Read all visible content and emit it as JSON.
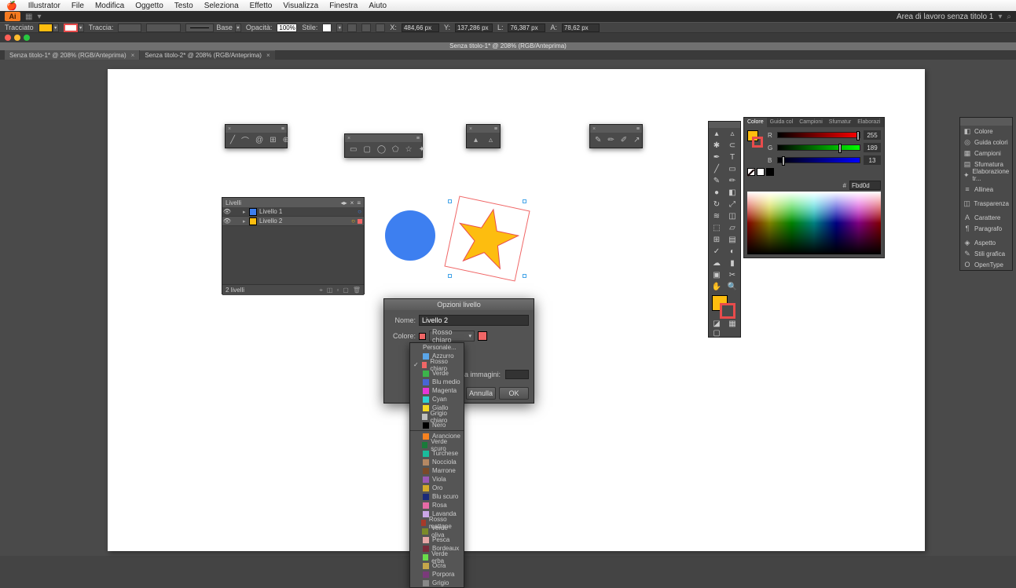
{
  "menubar": {
    "app": "Illustrator",
    "items": [
      "File",
      "Modifica",
      "Oggetto",
      "Testo",
      "Seleziona",
      "Effetto",
      "Visualizza",
      "Finestra",
      "Aiuto"
    ]
  },
  "appbar": {
    "workspace": "Area di lavoro senza titolo 1"
  },
  "controlbar": {
    "tracciato_label": "Tracciato",
    "traccia_label": "Traccia:",
    "base": "Base",
    "opacita_label": "Opacità:",
    "opacita": "100%",
    "stile_label": "Stile:",
    "x_label": "X:",
    "x": "484,66 px",
    "y_label": "Y:",
    "y": "137,286 px",
    "w_label": "L:",
    "w": "76,387 px",
    "h_label": "A:",
    "h": "78,62 px"
  },
  "titlebar": "Senza titolo-1* @ 208% (RGB/Anteprima)",
  "tabs": [
    {
      "label": "Senza titolo-1* @ 208% (RGB/Anteprima)",
      "active": true
    },
    {
      "label": "Senza titolo-2* @ 208% (RGB/Anteprima)",
      "active": false
    }
  ],
  "colorpanel": {
    "tabs": [
      "Colore",
      "Guida col",
      "Campioni",
      "Sfumatur",
      "Elaborazi"
    ],
    "r": "255",
    "g": "189",
    "b": "13",
    "hex": "Fbd0d"
  },
  "sidepanel": {
    "items": [
      {
        "icon": "◧",
        "label": "Colore"
      },
      {
        "icon": "◎",
        "label": "Guida colori"
      },
      {
        "icon": "▦",
        "label": "Campioni"
      },
      {
        "icon": "▤",
        "label": "Sfumatura"
      },
      {
        "icon": "✦",
        "label": "Elaborazione tr..."
      },
      {
        "icon": "≡",
        "label": "Allinea"
      },
      {
        "icon": "◫",
        "label": "Trasparenza"
      },
      {
        "icon": "A",
        "label": "Carattere"
      },
      {
        "icon": "¶",
        "label": "Paragrafo"
      },
      {
        "icon": "◈",
        "label": "Aspetto"
      },
      {
        "icon": "✎",
        "label": "Stili grafica"
      },
      {
        "icon": "O",
        "label": "OpenType"
      }
    ]
  },
  "layerspanel": {
    "title": "Livelli",
    "layers": [
      {
        "name": "Livello 1",
        "color": "#3d7ff0"
      },
      {
        "name": "Livello 2",
        "color": "#fdbd0f",
        "selected": true
      }
    ],
    "count": "2 livelli"
  },
  "dialog": {
    "title": "Opzioni livello",
    "nome_label": "Nome:",
    "nome": "Livello 2",
    "colore_label": "Colore:",
    "colore": "Rosso chiaro",
    "immagini_label": "a immagini:",
    "ok": "OK",
    "annulla": "Annulla"
  },
  "dropdown": {
    "personale": "Personale...",
    "items": [
      {
        "c": "#5aa5e8",
        "t": "Azzurro"
      },
      {
        "c": "#f06666",
        "t": "Rosso chiaro",
        "checked": true
      },
      {
        "c": "#3cb44b",
        "t": "Verde"
      },
      {
        "c": "#4666d4",
        "t": "Blu medio"
      },
      {
        "c": "#e834d9",
        "t": "Magenta"
      },
      {
        "c": "#2ed0d0",
        "t": "Cyan"
      },
      {
        "c": "#f5d922",
        "t": "Giallo"
      },
      {
        "c": "#bfbfbf",
        "t": "Grigio chiaro"
      },
      {
        "c": "#000",
        "t": "Nero"
      }
    ],
    "items2": [
      {
        "c": "#f58220",
        "t": "Arancione"
      },
      {
        "c": "#1a7a3a",
        "t": "Verde scuro"
      },
      {
        "c": "#1abc9c",
        "t": "Turchese"
      },
      {
        "c": "#b58863",
        "t": "Nocciola"
      },
      {
        "c": "#7a4a2a",
        "t": "Marrone"
      },
      {
        "c": "#9b59b6",
        "t": "Viola"
      },
      {
        "c": "#d4a92a",
        "t": "Oro"
      },
      {
        "c": "#1a2a7a",
        "t": "Blu scuro"
      },
      {
        "c": "#e66aa6",
        "t": "Rosa"
      },
      {
        "c": "#caa6e6",
        "t": "Lavanda"
      },
      {
        "c": "#a63a2a",
        "t": "Rosso mattone"
      },
      {
        "c": "#7a8a2a",
        "t": "Verde oliva"
      },
      {
        "c": "#e6a6a6",
        "t": "Pesca"
      },
      {
        "c": "#7a2a3a",
        "t": "Bordeaux"
      },
      {
        "c": "#6adc4a",
        "t": "Verde erba"
      },
      {
        "c": "#c6a64a",
        "t": "Ocra"
      },
      {
        "c": "#7a3a7a",
        "t": "Porpora"
      },
      {
        "c": "#888",
        "t": "Grigio"
      }
    ]
  }
}
